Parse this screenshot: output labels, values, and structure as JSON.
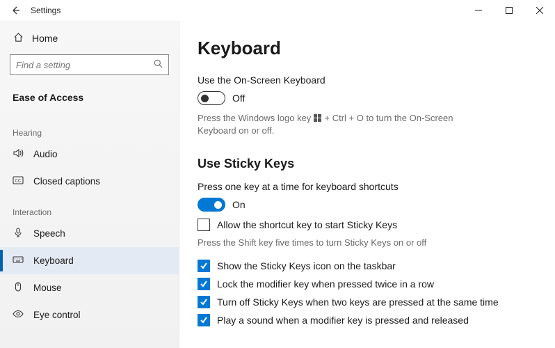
{
  "window": {
    "title": "Settings"
  },
  "sidebar": {
    "home": "Home",
    "search_placeholder": "Find a setting",
    "category": "Ease of Access",
    "groups": [
      {
        "label": "Hearing",
        "items": [
          {
            "id": "audio",
            "label": "Audio",
            "icon": "audio-icon"
          },
          {
            "id": "closed-captions",
            "label": "Closed captions",
            "icon": "cc-icon"
          }
        ]
      },
      {
        "label": "Interaction",
        "items": [
          {
            "id": "speech",
            "label": "Speech",
            "icon": "mic-icon"
          },
          {
            "id": "keyboard",
            "label": "Keyboard",
            "icon": "keyboard-icon",
            "selected": true
          },
          {
            "id": "mouse",
            "label": "Mouse",
            "icon": "mouse-icon"
          },
          {
            "id": "eye-control",
            "label": "Eye control",
            "icon": "eye-icon"
          }
        ]
      }
    ]
  },
  "content": {
    "title": "Keyboard",
    "osk": {
      "label": "Use the On-Screen Keyboard",
      "state": "Off",
      "hint_pre": "Press the Windows logo key ",
      "hint_post": " + Ctrl + O to turn the On-Screen Keyboard on or off."
    },
    "sticky": {
      "heading": "Use Sticky Keys",
      "label": "Press one key at a time for keyboard shortcuts",
      "state": "On",
      "allow_shortcut": {
        "label": "Allow the shortcut key to start Sticky Keys",
        "checked": false
      },
      "allow_hint": "Press the Shift key five times to turn Sticky Keys on or off",
      "options": [
        {
          "label": "Show the Sticky Keys icon on the taskbar",
          "checked": true
        },
        {
          "label": "Lock the modifier key when pressed twice in a row",
          "checked": true
        },
        {
          "label": "Turn off Sticky Keys when two keys are pressed at the same time",
          "checked": true
        },
        {
          "label": "Play a sound when a modifier key is pressed and released",
          "checked": true
        }
      ]
    }
  }
}
